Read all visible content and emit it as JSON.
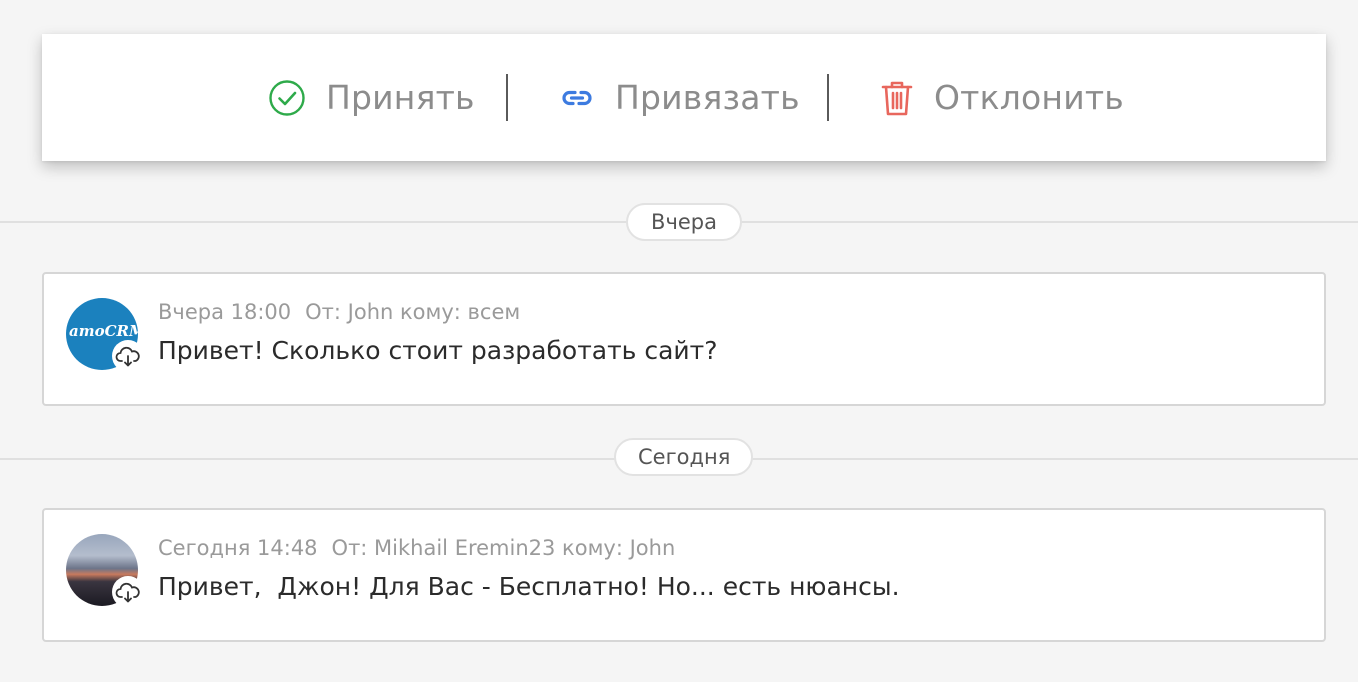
{
  "actions": {
    "accept_label": "Принять",
    "bind_label": "Привязать",
    "reject_label": "Отклонить",
    "accept_color": "#2eaa4a",
    "bind_color": "#3d7be0",
    "reject_color": "#e8675d"
  },
  "dividers": {
    "yesterday": "Вчера",
    "today": "Сегодня"
  },
  "messages": [
    {
      "time": "Вчера 18:00",
      "route": "От: John кому: всем",
      "text": "Привет! Сколько стоит разработать сайт?",
      "avatar_text": "amoCRM",
      "avatar_color": "#1b81be"
    },
    {
      "time": "Сегодня 14:48",
      "route": "От: Mikhail Eremin23 кому: John",
      "text": "Привет,  Джон! Для Вас - Бесплатно! Но... есть нюансы."
    }
  ]
}
